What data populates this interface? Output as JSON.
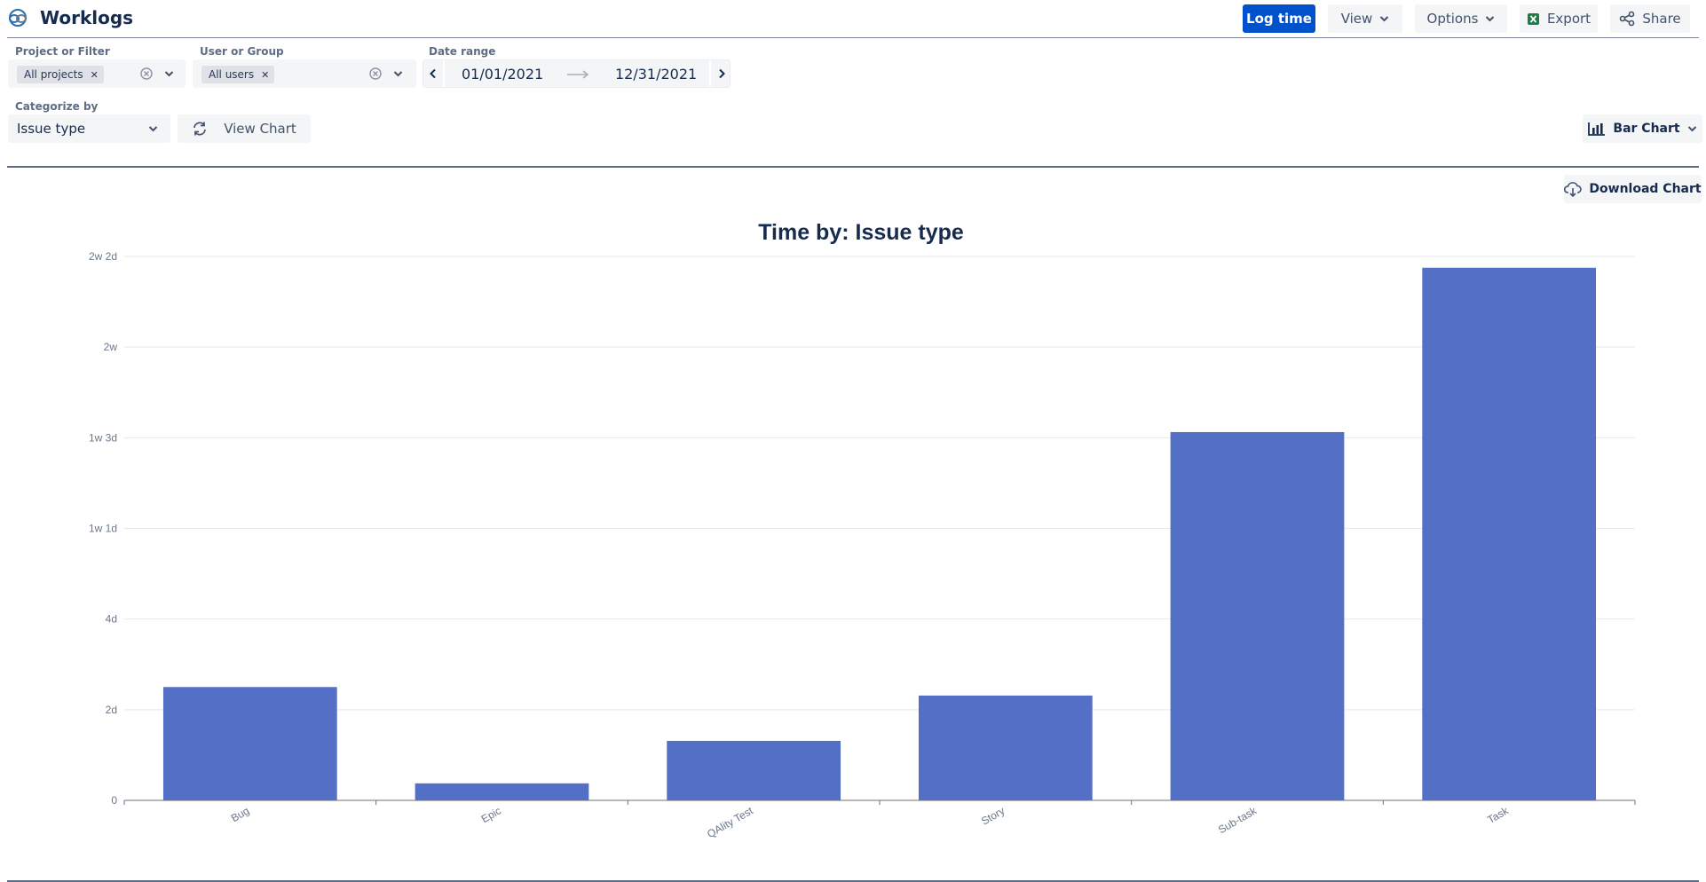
{
  "header": {
    "title": "Worklogs",
    "log_time": "Log time",
    "view": "View",
    "options": "Options",
    "export": "Export",
    "share": "Share"
  },
  "filters": {
    "project_label": "Project or Filter",
    "project_tag": "All projects",
    "user_label": "User or Group",
    "user_tag": "All users",
    "date_label": "Date range",
    "date_from": "01/01/2021",
    "date_to": "12/31/2021",
    "categorize_label": "Categorize by",
    "categorize_value": "Issue type",
    "view_chart": "View Chart",
    "chart_type": "Bar Chart"
  },
  "download_chart": "Download Chart",
  "colors": {
    "primary": "#0052cc",
    "bar": "#546fc6",
    "export_icon": "#1d7e45"
  },
  "chart_data": {
    "type": "bar",
    "title": "Time by: Issue type",
    "categories": [
      "Bug",
      "Epic",
      "QAlity Test",
      "Story",
      "Sub-task",
      "Task"
    ],
    "values_hours": [
      20,
      3,
      10.5,
      18.5,
      65,
      94
    ],
    "ytick_labels": [
      "0",
      "2d",
      "4d",
      "1w 1d",
      "1w 3d",
      "2w",
      "2w 2d"
    ],
    "ytick_values_hours": [
      0,
      16,
      32,
      48,
      64,
      80,
      96
    ],
    "ylim_hours": [
      0,
      96
    ],
    "grid": true,
    "legend": false
  }
}
